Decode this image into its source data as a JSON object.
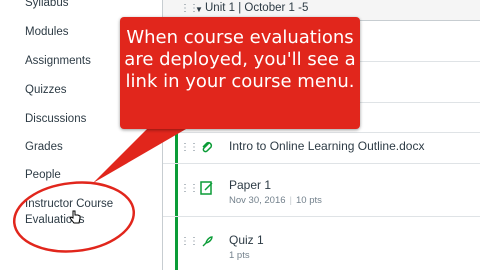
{
  "nav": {
    "items": [
      "Syllabus",
      "Modules",
      "Assignments",
      "Quizzes",
      "Discussions",
      "Grades",
      "People"
    ],
    "highlighted_item": "Instructor Course Evaluations"
  },
  "module": {
    "title": "Unit 1 | October 1 -5"
  },
  "items": [
    {
      "title": "Intro to Online Learning Outline.docx",
      "icon": "attachment-icon"
    },
    {
      "title": "Paper 1",
      "date": "Nov 30, 2016",
      "points": "10 pts",
      "icon": "assignment-icon"
    },
    {
      "title": "Quiz 1",
      "points": "1 pts",
      "icon": "quiz-rocket-icon"
    }
  ],
  "callout": {
    "text": "When course evaluations are deployed, you'll see a link in your course menu."
  },
  "colors": {
    "callout": "#e1261c",
    "published_bar": "#0b9c37",
    "text": "#2d3b45"
  }
}
